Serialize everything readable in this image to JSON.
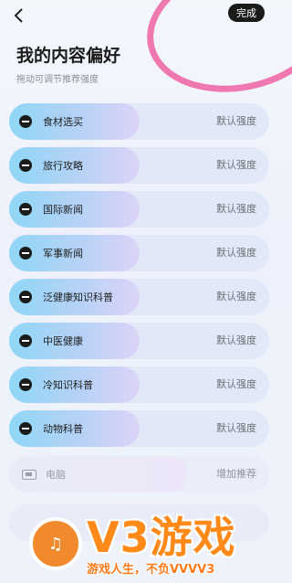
{
  "header": {
    "done_label": "完成"
  },
  "page": {
    "title": "我的内容偏好",
    "subtitle": "拖动可调节推荐强度"
  },
  "topics": [
    {
      "label": "食材选买",
      "strength": "默认强度"
    },
    {
      "label": "旅行攻略",
      "strength": "默认强度"
    },
    {
      "label": "国际新闻",
      "strength": "默认强度"
    },
    {
      "label": "军事新闻",
      "strength": "默认强度"
    },
    {
      "label": "泛健康知识科普",
      "strength": "默认强度"
    },
    {
      "label": "中医健康",
      "strength": "默认强度"
    },
    {
      "label": "冷知识科普",
      "strength": "默认强度"
    },
    {
      "label": "动物科普",
      "strength": "默认强度"
    }
  ],
  "disabled_topic": {
    "label": "电脑",
    "action": "增加推荐"
  },
  "watermark": {
    "brand": "V3游戏",
    "slogan": "游戏人生，不负VVVV3"
  },
  "colors": {
    "accent_pink": "#f06aa8",
    "pill_start": "#8fd6f5",
    "pill_end": "#dcd4f7",
    "watermark_orange": "#ff8a1a"
  },
  "icons": {
    "back": "chevron-left-icon",
    "remove": "minus-circle-icon",
    "computer": "computer-icon"
  }
}
